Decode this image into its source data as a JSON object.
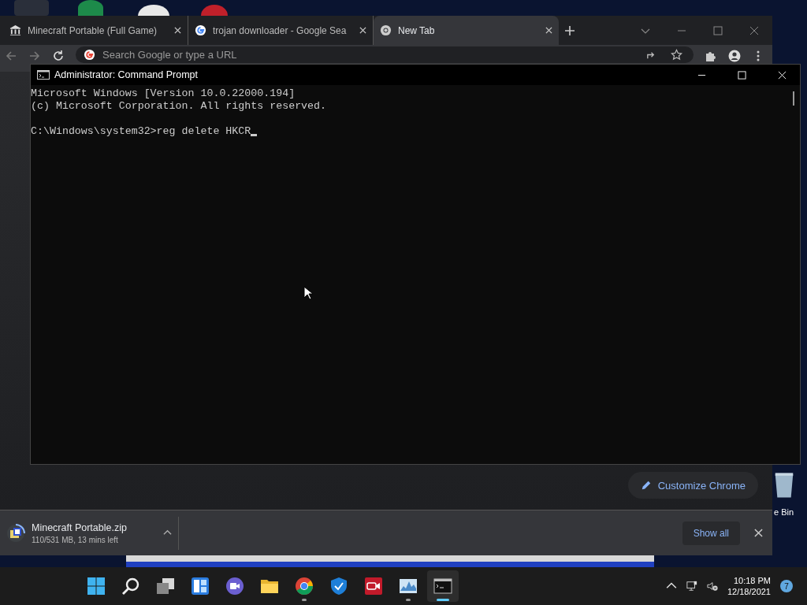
{
  "browser": {
    "tabs": [
      {
        "title": "Minecraft Portable (Full Game)",
        "kind": "site",
        "selected": false
      },
      {
        "title": "trojan downloader - Google Sea",
        "kind": "search",
        "selected": false
      },
      {
        "title": "New Tab",
        "kind": "newtab",
        "selected": true
      }
    ],
    "omnibox": {
      "placeholder": "Search Google or type a URL"
    },
    "customize_button": "Customize Chrome",
    "download": {
      "filename": "Minecraft Portable.zip",
      "status": "110/531 MB, 13 mins left"
    },
    "show_all": "Show all"
  },
  "terminal": {
    "title": "Administrator: Command Prompt",
    "output": [
      "Microsoft Windows [Version 10.0.22000.194]",
      "(c) Microsoft Corporation. All rights reserved."
    ],
    "prompt": "C:\\Windows\\system32>reg delete HKCR"
  },
  "desktop": {
    "icons": [
      {
        "label": "e Bin"
      }
    ]
  },
  "taskbar": {
    "apps": [
      {
        "kind": "start",
        "running": false,
        "active": false
      },
      {
        "kind": "search",
        "running": false,
        "active": false
      },
      {
        "kind": "taskview",
        "running": false,
        "active": false
      },
      {
        "kind": "widgets",
        "running": false,
        "active": false
      },
      {
        "kind": "chat",
        "running": false,
        "active": false
      },
      {
        "kind": "folder",
        "running": false,
        "active": false
      },
      {
        "kind": "chrome",
        "running": true,
        "active": false
      },
      {
        "kind": "shield",
        "running": false,
        "active": false
      },
      {
        "kind": "camera",
        "running": false,
        "active": false
      },
      {
        "kind": "monitor",
        "running": true,
        "active": false
      },
      {
        "kind": "terminal",
        "running": true,
        "active": true
      }
    ],
    "clock": {
      "time": "10:18 PM",
      "date": "12/18/2021"
    },
    "notifications": "7"
  }
}
